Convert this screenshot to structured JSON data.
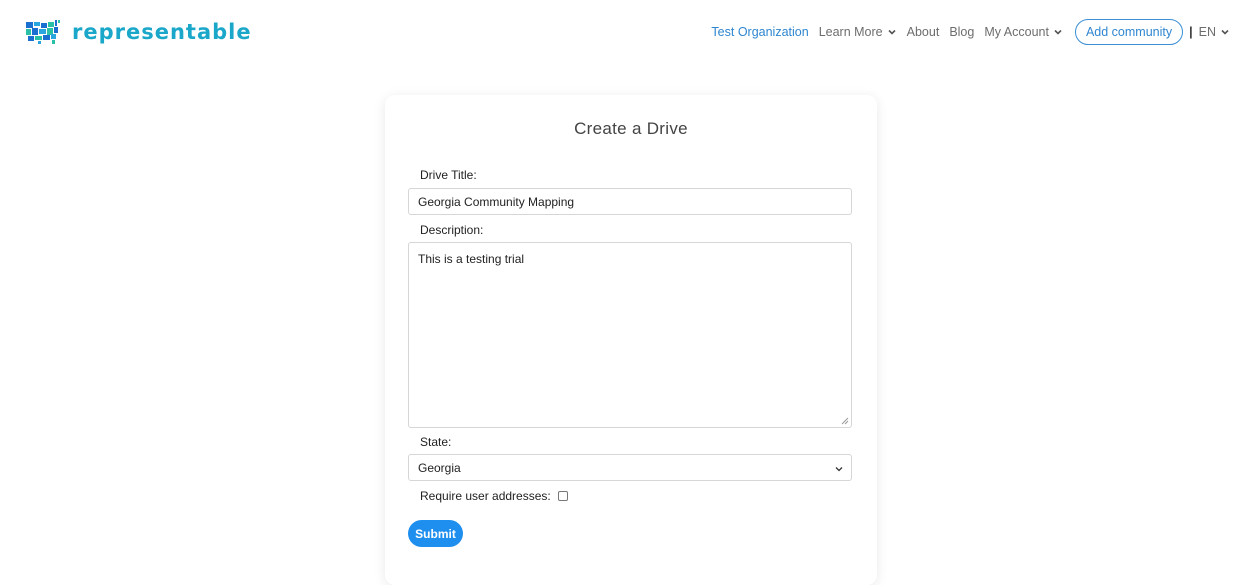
{
  "brand": {
    "name": "representable",
    "color": "#1aa7c9"
  },
  "nav": {
    "organization": "Test Organization",
    "learn_more": "Learn More",
    "about": "About",
    "blog": "Blog",
    "my_account": "My Account",
    "add_community": "Add community",
    "separator": "|",
    "language": "EN"
  },
  "form": {
    "title": "Create a Drive",
    "drive_title_label": "Drive Title:",
    "drive_title_value": "Georgia Community Mapping",
    "description_label": "Description:",
    "description_value": "This is a testing trial",
    "state_label": "State:",
    "state_value": "Georgia",
    "require_addresses_label": "Require user addresses:",
    "require_addresses_checked": false,
    "submit_label": "Submit"
  },
  "colors": {
    "accent": "#1f8fef",
    "link": "#2f86d0"
  },
  "icons": {
    "logo": "us-map-logo-icon",
    "dropdown": "chevron-down-icon"
  }
}
